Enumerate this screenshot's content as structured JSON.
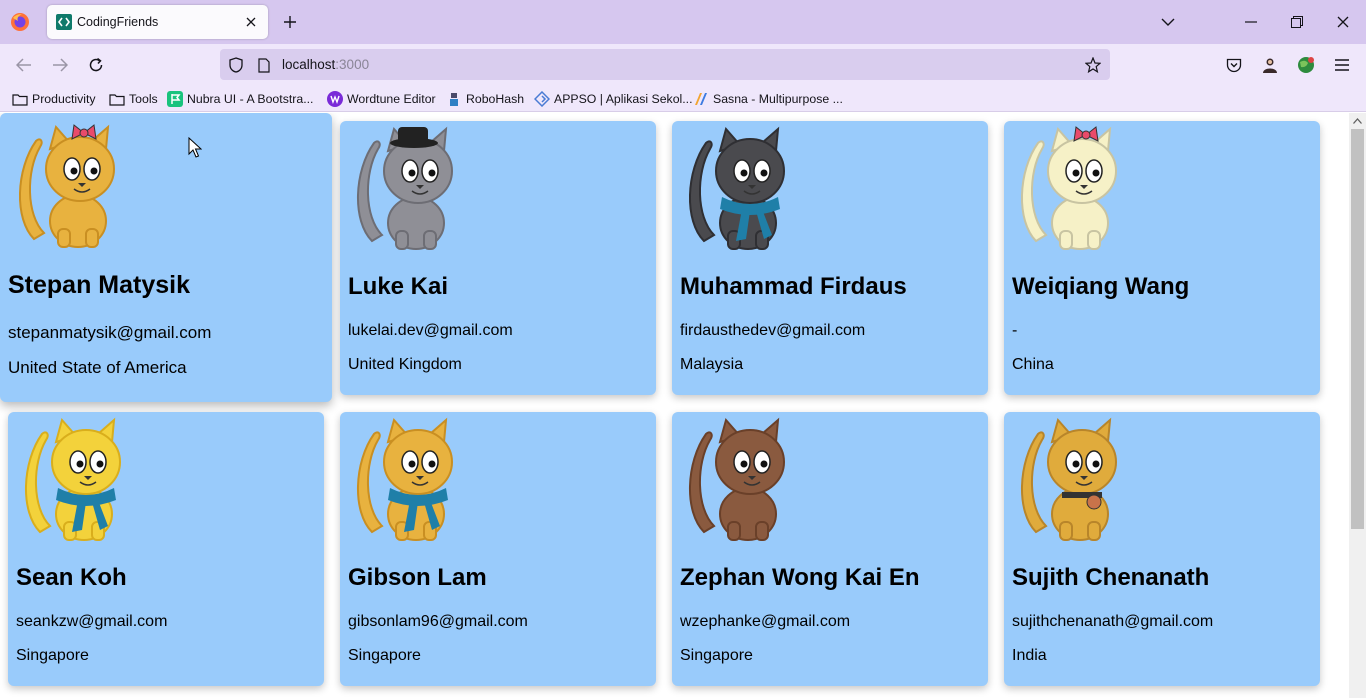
{
  "browser": {
    "tab_title": "CodingFriends",
    "url_host": "localhost",
    "url_port": ":3000",
    "bookmarks": [
      {
        "label": "Productivity",
        "icon": "folder-icon"
      },
      {
        "label": "Tools",
        "icon": "folder-icon"
      },
      {
        "label": "Nubra UI - A Bootstra...",
        "icon": "nubra-flag-icon"
      },
      {
        "label": "Wordtune Editor",
        "icon": "wordtune-icon"
      },
      {
        "label": "RoboHash",
        "icon": "robohash-icon"
      },
      {
        "label": "APPSO | Aplikasi Sekol...",
        "icon": "appso-icon"
      },
      {
        "label": "Sasna - Multipurpose ...",
        "icon": "sasna-icon"
      }
    ]
  },
  "colors": {
    "card_bg": "#99cbfb",
    "tabbar_bg": "#d6c7ef",
    "toolbar_bg": "#efe7fb"
  },
  "friends": [
    {
      "name": "Stepan Matysik",
      "email": "stepanmatysik@gmail.com",
      "country": "United State of America",
      "avatar": "orange-cat-pink-bow-icon"
    },
    {
      "name": "Luke Kai",
      "email": "lukelai.dev@gmail.com",
      "country": "United Kingdom",
      "avatar": "gray-cat-black-hat-icon"
    },
    {
      "name": "Muhammad Firdaus",
      "email": "firdausthedev@gmail.com",
      "country": "Malaysia",
      "avatar": "dark-cat-blue-scarf-icon"
    },
    {
      "name": "Weiqiang Wang",
      "email": "-",
      "country": "China",
      "avatar": "cream-cat-pink-bow-icon"
    },
    {
      "name": "Sean Koh",
      "email": "seankzw@gmail.com",
      "country": "Singapore",
      "avatar": "yellow-cat-blue-scarf-icon"
    },
    {
      "name": "Gibson Lam",
      "email": "gibsonlam96@gmail.com",
      "country": "Singapore",
      "avatar": "orange-cat-blue-scarf-icon"
    },
    {
      "name": "Zephan Wong Kai En",
      "email": "wzephanke@gmail.com",
      "country": "Singapore",
      "avatar": "brown-cat-icon"
    },
    {
      "name": "Sujith Chenanath",
      "email": "sujithchenanath@gmail.com",
      "country": "India",
      "avatar": "spotted-cat-collar-icon"
    }
  ]
}
